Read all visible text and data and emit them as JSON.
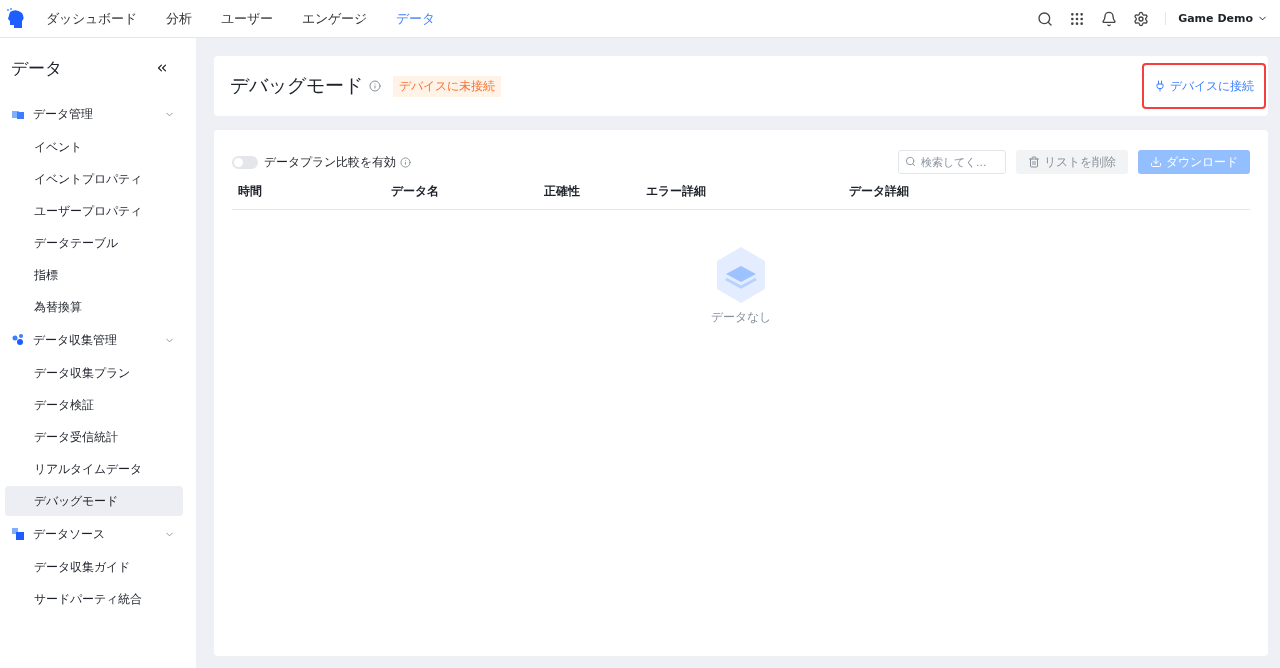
{
  "top_nav": {
    "tabs": [
      {
        "label": "ダッシュボード",
        "selected": false
      },
      {
        "label": "分析",
        "selected": false
      },
      {
        "label": "ユーザー",
        "selected": false
      },
      {
        "label": "エンゲージ",
        "selected": false
      },
      {
        "label": "データ",
        "selected": true
      }
    ],
    "account": "Game Demo"
  },
  "sidebar": {
    "title": "データ",
    "groups": [
      {
        "label": "データ管理",
        "expanded": true,
        "items": [
          {
            "label": "イベント",
            "selected": false
          },
          {
            "label": "イベントプロパティ",
            "selected": false
          },
          {
            "label": "ユーザープロパティ",
            "selected": false
          },
          {
            "label": "データテーブル",
            "selected": false
          },
          {
            "label": "指標",
            "selected": false
          },
          {
            "label": "為替換算",
            "selected": false
          }
        ]
      },
      {
        "label": "データ収集管理",
        "expanded": true,
        "items": [
          {
            "label": "データ収集プラン",
            "selected": false
          },
          {
            "label": "データ検証",
            "selected": false
          },
          {
            "label": "データ受信統計",
            "selected": false
          },
          {
            "label": "リアルタイムデータ",
            "selected": false
          },
          {
            "label": "デバッグモード",
            "selected": true
          }
        ]
      },
      {
        "label": "データソース",
        "expanded": true,
        "items": [
          {
            "label": "データ収集ガイド",
            "selected": false
          },
          {
            "label": "サードパーティ統合",
            "selected": false
          }
        ]
      }
    ]
  },
  "header": {
    "title": "デバッグモード",
    "status": "デバイスに未接続",
    "connect_button": {
      "label": "デバイスに接続",
      "highlighted": true
    }
  },
  "toolbar": {
    "toggle": {
      "label": "データプラン比較を有効",
      "on": false
    },
    "search": {
      "placeholder": "検索してく..."
    },
    "buttons": [
      {
        "label": "リストを削除",
        "kind": "delete",
        "disabled": true
      },
      {
        "label": "ダウンロード",
        "kind": "download",
        "disabled": true
      }
    ]
  },
  "table": {
    "columns": [
      "時間",
      "データ名",
      "正確性",
      "エラー詳細",
      "データ詳細"
    ],
    "empty_text": "データなし"
  }
}
